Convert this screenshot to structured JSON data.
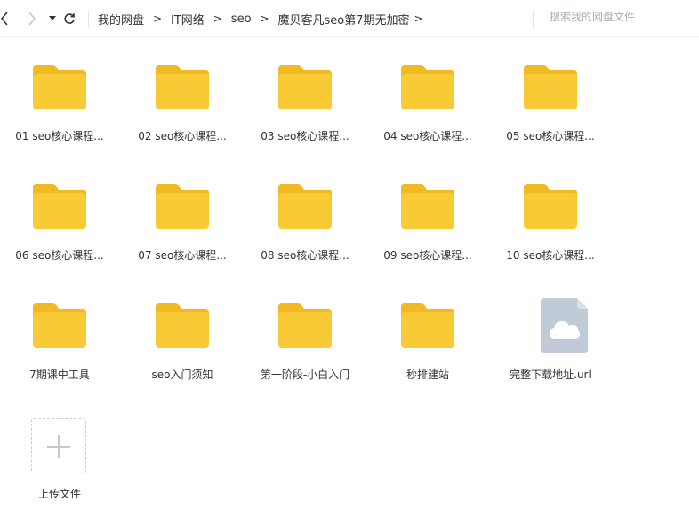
{
  "toolbar": {
    "breadcrumb": [
      "我的网盘",
      "IT网络",
      "seo",
      "魔贝客凡seo第7期无加密"
    ],
    "crumb_separator": ">",
    "search_placeholder": "搜索我的网盘文件"
  },
  "colors": {
    "folder_back": "#f2ba22",
    "folder_front": "#f8cb36",
    "file_doc": "#c0cbd7",
    "file_fold": "#d8e0e8"
  },
  "items": [
    {
      "label": "01 seo核心课程...",
      "type": "folder"
    },
    {
      "label": "02 seo核心课程...",
      "type": "folder"
    },
    {
      "label": "03 seo核心课程...",
      "type": "folder"
    },
    {
      "label": "04 seo核心课程...",
      "type": "folder"
    },
    {
      "label": "05 seo核心课程...",
      "type": "folder"
    },
    {
      "label": "06 seo核心课程...",
      "type": "folder"
    },
    {
      "label": "07 seo核心课程...",
      "type": "folder"
    },
    {
      "label": "08 seo核心课程...",
      "type": "folder"
    },
    {
      "label": "09 seo核心课程...",
      "type": "folder"
    },
    {
      "label": "10 seo核心课程...",
      "type": "folder"
    },
    {
      "label": "7期课中工具",
      "type": "folder"
    },
    {
      "label": "seo入门须知",
      "type": "folder"
    },
    {
      "label": "第一阶段-小白入门",
      "type": "folder"
    },
    {
      "label": "秒排建站",
      "type": "folder"
    },
    {
      "label": "完整下载地址.url",
      "type": "url-file"
    }
  ],
  "upload": {
    "label": "上传文件"
  }
}
